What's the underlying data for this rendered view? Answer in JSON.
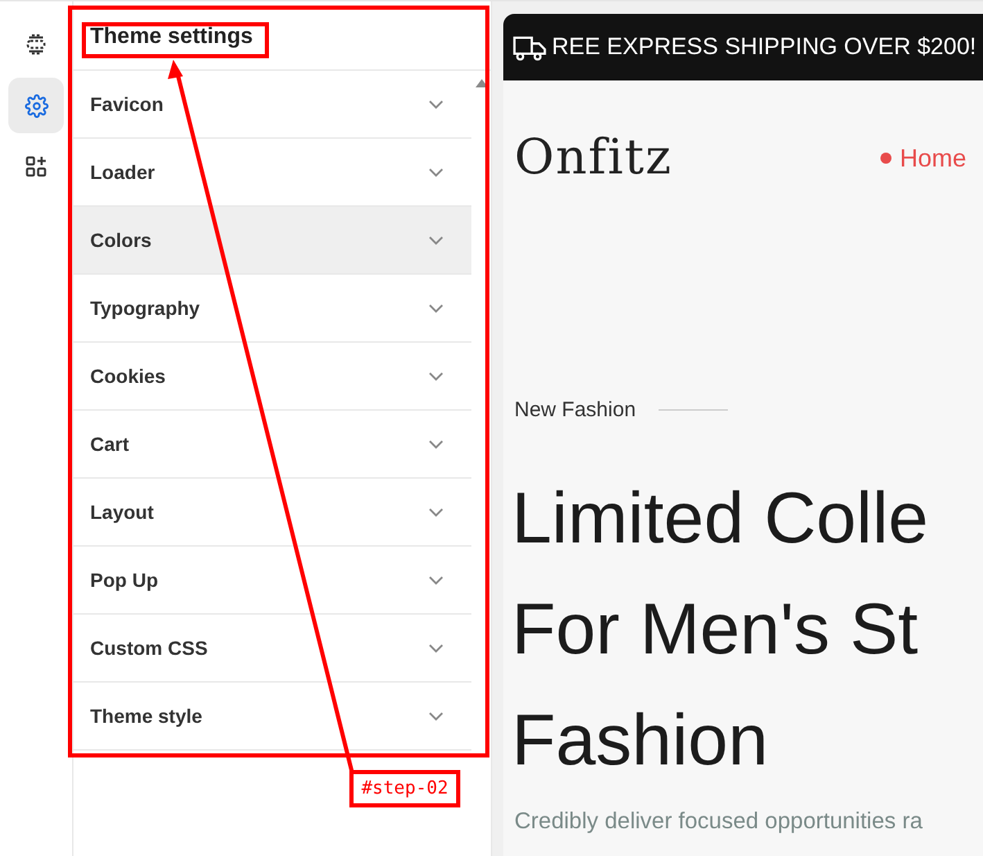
{
  "rail": [
    {
      "kind": "layout",
      "selected": false
    },
    {
      "kind": "gear",
      "selected": true
    },
    {
      "kind": "apps",
      "selected": false
    }
  ],
  "panel": {
    "title": "Theme settings",
    "items": [
      {
        "label": "Favicon",
        "selected": false
      },
      {
        "label": "Loader",
        "selected": false
      },
      {
        "label": "Colors",
        "selected": true
      },
      {
        "label": "Typography",
        "selected": false
      },
      {
        "label": "Cookies",
        "selected": false
      },
      {
        "label": "Cart",
        "selected": false
      },
      {
        "label": "Layout",
        "selected": false
      },
      {
        "label": "Pop Up",
        "selected": false
      },
      {
        "label": "Custom CSS",
        "selected": false
      },
      {
        "label": "Theme style",
        "selected": false
      }
    ]
  },
  "preview": {
    "banner": "REE EXPRESS SHIPPING OVER $200!",
    "logo": "Onfitz",
    "nav": [
      {
        "label": "Home",
        "selected": true
      }
    ],
    "eyebrow": "New Fashion",
    "heading": [
      "Limited Colle",
      "For Men's St",
      "Fashion"
    ],
    "description": "Credibly deliver focused opportunities ra"
  },
  "annotation": {
    "label": "#step-02"
  }
}
